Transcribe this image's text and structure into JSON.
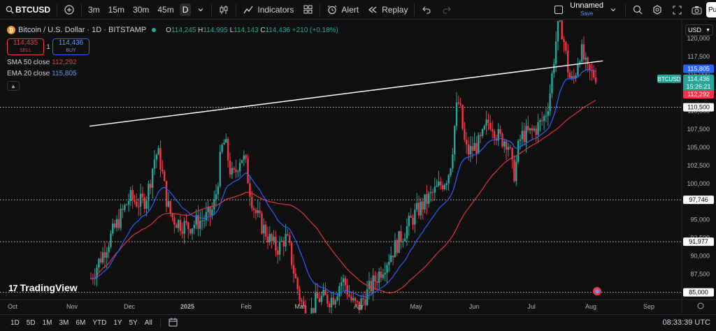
{
  "toolbar": {
    "symbol": "BTCUSD",
    "timeframes": [
      "3m",
      "15m",
      "30m",
      "45m",
      "D"
    ],
    "active_timeframe": "D",
    "indicators_label": "Indicators",
    "alert_label": "Alert",
    "replay_label": "Replay",
    "layout_name": "Unnamed",
    "layout_status": "Save",
    "publish_label": "Pu"
  },
  "legend": {
    "title": "Bitcoin / U.S. Dollar · 1D · BITSTAMP",
    "open_key": "O",
    "open": "114,245",
    "high_key": "H",
    "high": "114,995",
    "low_key": "L",
    "low": "114,143",
    "close_key": "C",
    "close": "114,436",
    "change": "+210 (+0.18%)",
    "sell_price": "114,435",
    "sell_label": "SELL",
    "spread": "1",
    "buy_price": "114,436",
    "buy_label": "BUY",
    "sma_label": "SMA 50 close",
    "sma_value": "112,292",
    "ema_label": "EMA 20 close",
    "ema_value": "115,805"
  },
  "price_scale": {
    "currency": "USD",
    "ticks": [
      "120,000",
      "117,500",
      "115,000",
      "112,500",
      "110,000",
      "107,500",
      "105,000",
      "102,500",
      "100,000",
      "97,500",
      "95,000",
      "92,500",
      "90,000",
      "87,500",
      "85,000"
    ],
    "tags": {
      "ema": "115,805",
      "last_price": "114,436",
      "countdown": "15:26:21",
      "sma": "112,292",
      "h1": "110,500",
      "h2": "97,746",
      "h3": "91,977",
      "h4": "85,000",
      "symbol_tag": "BTCUSD"
    }
  },
  "time_axis": [
    "Oct",
    "Nov",
    "Dec",
    "2025",
    "Feb",
    "Mar",
    "Apr",
    "May",
    "Jun",
    "Jul",
    "Aug",
    "Sep"
  ],
  "logo_text": "TradingView",
  "bottom": {
    "ranges": [
      "1D",
      "5D",
      "1M",
      "3M",
      "6M",
      "YTD",
      "1Y",
      "5Y",
      "All"
    ],
    "clock": "08:33:39 UTC"
  },
  "colors": {
    "up": "#26a69a",
    "down": "#f23645",
    "sma": "#e0343f",
    "ema": "#2962ff",
    "trendline": "#ffffff"
  },
  "chart_data": {
    "type": "candlestick",
    "ylim": [
      84000,
      122500
    ],
    "horizontal_levels": [
      110500,
      97746,
      91977,
      85000
    ],
    "trendline": [
      [
        0.125,
        107900
      ],
      [
        0.842,
        116900
      ]
    ],
    "month_anchors": [
      {
        "label": "Nov",
        "price": 81500
      },
      {
        "label": "Dec",
        "price": 98000
      },
      {
        "label": "2025",
        "price": 94000
      },
      {
        "label": "Feb",
        "price": 98000
      },
      {
        "label": "Mar",
        "price": 85000
      },
      {
        "label": "Apr",
        "price": 83000
      },
      {
        "label": "May",
        "price": 96000
      },
      {
        "label": "Jun",
        "price": 105000
      },
      {
        "label": "Jul",
        "price": 107000
      },
      {
        "label": "Aug",
        "price": 115000
      }
    ]
  }
}
